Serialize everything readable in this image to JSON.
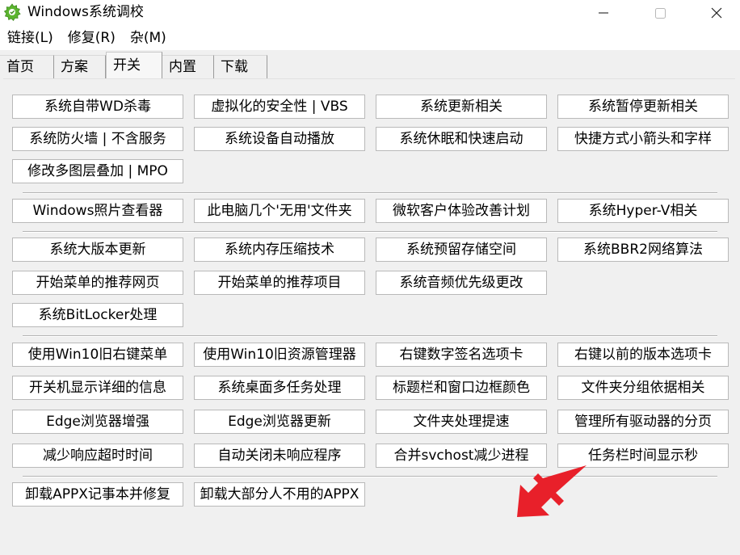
{
  "window": {
    "title": "Windows系统调校",
    "minimize_glyph": "—",
    "maximize_glyph": "☐",
    "close_glyph": "✕",
    "icon": "app-gear-icon",
    "icon_color": "#5cb52f"
  },
  "menu": [
    {
      "label": "链接(L)"
    },
    {
      "label": "修复(R)"
    },
    {
      "label": "杂(M)"
    }
  ],
  "tabs": [
    {
      "label": "首页",
      "active": false
    },
    {
      "label": "方案",
      "active": false
    },
    {
      "label": "开关",
      "active": true
    },
    {
      "label": "内置",
      "active": false
    },
    {
      "label": "下载",
      "active": false
    }
  ],
  "groups": [
    {
      "buttons": [
        "系统自带WD杀毒",
        "虚拟化的安全性 | VBS",
        "系统更新相关",
        "系统暂停更新相关",
        "系统防火墙 | 不含服务",
        "系统设备自动播放",
        "系统休眠和快速启动",
        "快捷方式小箭头和字样",
        "修改多图层叠加 | MPO"
      ]
    },
    {
      "buttons": [
        "Windows照片查看器",
        "此电脑几个'无用'文件夹",
        "微软客户体验改善计划",
        "系统Hyper-V相关"
      ]
    },
    {
      "buttons": [
        "系统大版本更新",
        "系统内存压缩技术",
        "系统预留存储空间",
        "系统BBR2网络算法",
        "开始菜单的推荐网页",
        "开始菜单的推荐项目",
        "系统音频优先级更改",
        "系统BitLocker处理"
      ]
    },
    {
      "buttons": [
        "使用Win10旧右键菜单",
        "使用Win10旧资源管理器",
        "右键数字签名选项卡",
        "右键以前的版本选项卡",
        "开关机显示详细的信息",
        "系统桌面多任务处理",
        "标题栏和窗口边框颜色",
        "文件夹分组依据相关",
        "Edge浏览器增强",
        "Edge浏览器更新",
        "文件夹处理提速",
        "管理所有驱动器的分页",
        "减少响应超时时间",
        "自动关闭未响应程序",
        "合并svchost减少进程",
        "任务栏时间显示秒"
      ]
    },
    {
      "buttons": [
        "卸载APPX记事本并修复",
        "卸载大部分人不用的APPX"
      ]
    }
  ],
  "annotation": {
    "icon": "red-arrow-icon",
    "color": "#e8202a"
  }
}
